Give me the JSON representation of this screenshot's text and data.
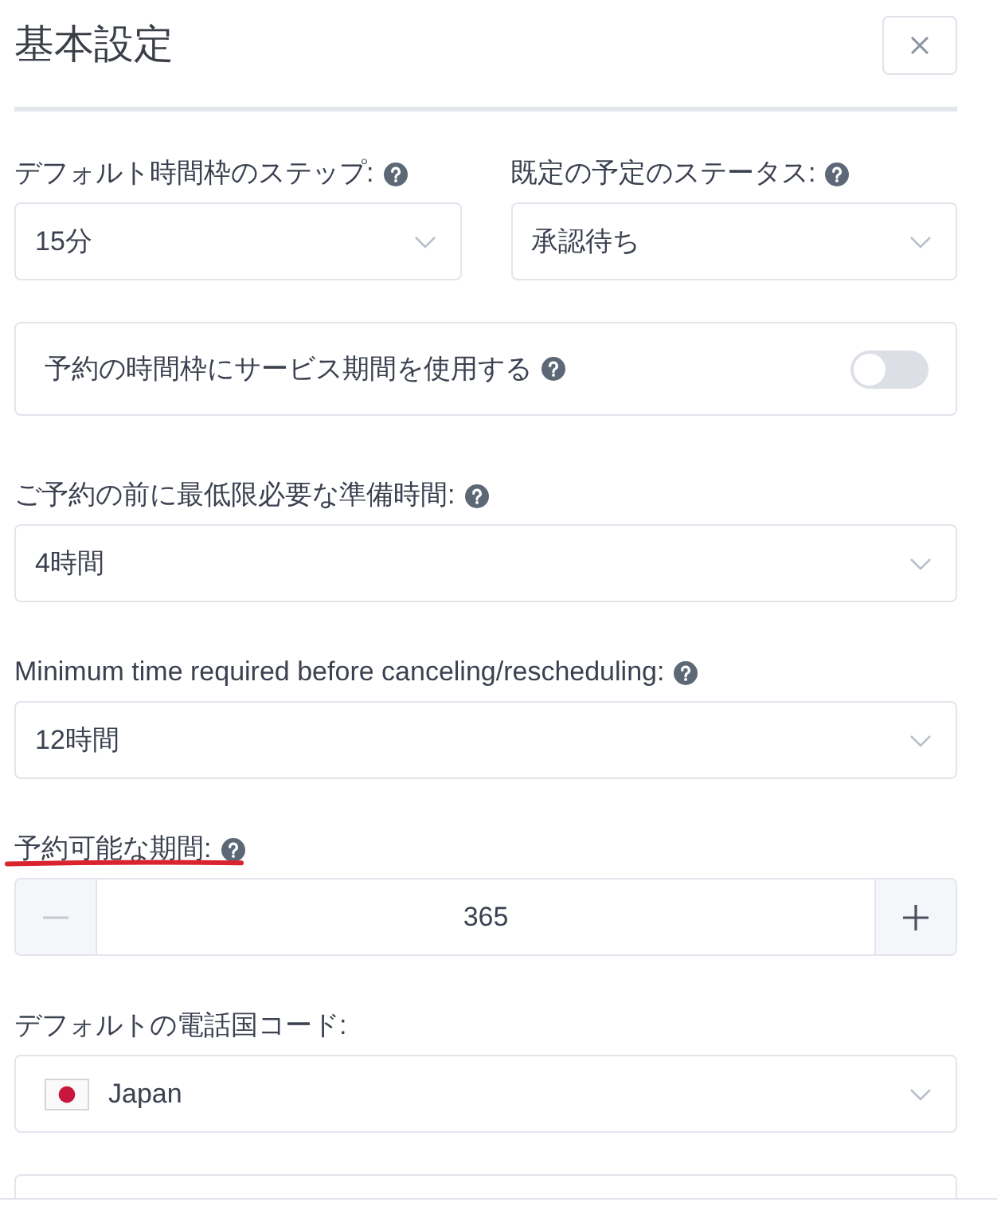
{
  "dialog": {
    "title": "基本設定"
  },
  "rows": [
    {
      "fields": [
        {
          "kind": "select",
          "label": "デフォルト時間枠のステップ:",
          "help": true,
          "underlined": false,
          "value": "15分"
        },
        {
          "kind": "select",
          "label": "既定の予定のステータス:",
          "help": true,
          "underlined": false,
          "value": "承認待ち"
        }
      ]
    },
    {
      "fields": [
        {
          "kind": "toggle",
          "label": "予約の時間枠にサービス期間を使用する",
          "help": true,
          "on": false
        }
      ]
    },
    {
      "fields": [
        {
          "kind": "select",
          "label": "ご予約の前に最低限必要な準備時間:",
          "help": true,
          "underlined": false,
          "value": "4時間"
        }
      ]
    },
    {
      "fields": [
        {
          "kind": "select",
          "label": "Minimum time required before canceling/rescheduling:",
          "help": true,
          "underlined": false,
          "value": "12時間"
        }
      ]
    },
    {
      "fields": [
        {
          "kind": "stepper",
          "label": "予約可能な期間:",
          "help": true,
          "underlined": true,
          "value": "365"
        }
      ]
    },
    {
      "fields": [
        {
          "kind": "country_select",
          "label": "デフォルトの電話国コード:",
          "help": false,
          "underlined": false,
          "value": "Japan"
        }
      ]
    }
  ],
  "partial_card_below": true
}
